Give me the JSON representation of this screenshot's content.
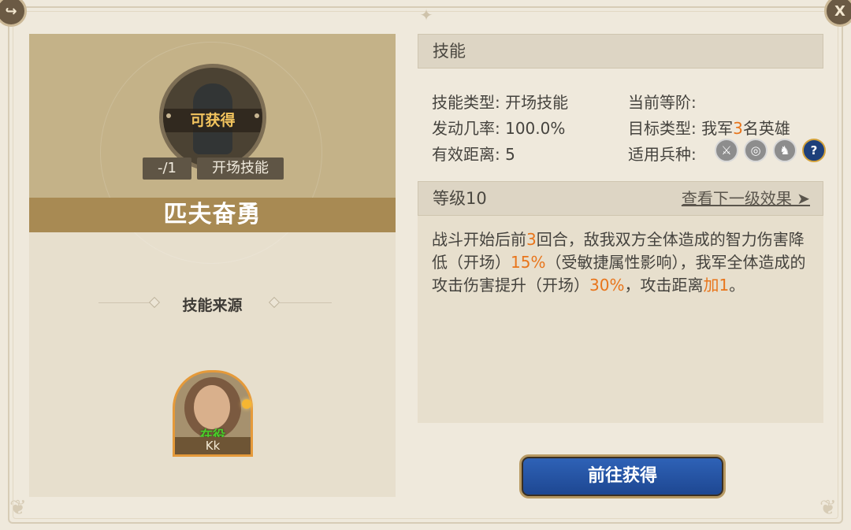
{
  "icons": {
    "back": "share-arrow-icon",
    "close": "close-x-icon",
    "compass": "compass-star-icon",
    "troops": [
      "sword-icon",
      "archery-target-icon",
      "horse-icon",
      "question-icon"
    ]
  },
  "close_label": "X",
  "colors": {
    "accent_orange": "#e8751b",
    "title_bar": "#a88a53",
    "button_blue": "#1d4690",
    "status_green": "#4ccf2a"
  },
  "skill_card": {
    "status_label": "可获得",
    "count": "-/1",
    "type_tag": "开场技能",
    "name": "匹夫奋勇"
  },
  "source": {
    "title": "技能来源",
    "hero": {
      "status": "在役",
      "name": "Kk"
    }
  },
  "skill_info": {
    "header": "技能",
    "skill_type_label": "技能类型:",
    "skill_type_value": "开场技能",
    "trigger_rate_label": "发动几率:",
    "trigger_rate_value": "100.0%",
    "range_label": "有效距离:",
    "range_value": "5",
    "current_rank_label": "当前等阶:",
    "target_type_label": "目标类型:",
    "target_prefix": "我军",
    "target_count": "3",
    "target_suffix": "名英雄",
    "troop_label": "适用兵种:"
  },
  "level": {
    "header": "等级10",
    "next_link": "查看下一级效果 ➤",
    "desc": {
      "p1": "战斗开始后前",
      "n1": "3",
      "p2": "回合，敌我双方全体造成的智力伤害降低（开场）",
      "n2": "15%",
      "p3": "（受敏捷属性影响），我军全体造成的攻击伤害提升（开场）",
      "n3": "30%",
      "p4": "，攻击距离",
      "n4": "加1",
      "p5": "。"
    }
  },
  "go_button": "前往获得"
}
